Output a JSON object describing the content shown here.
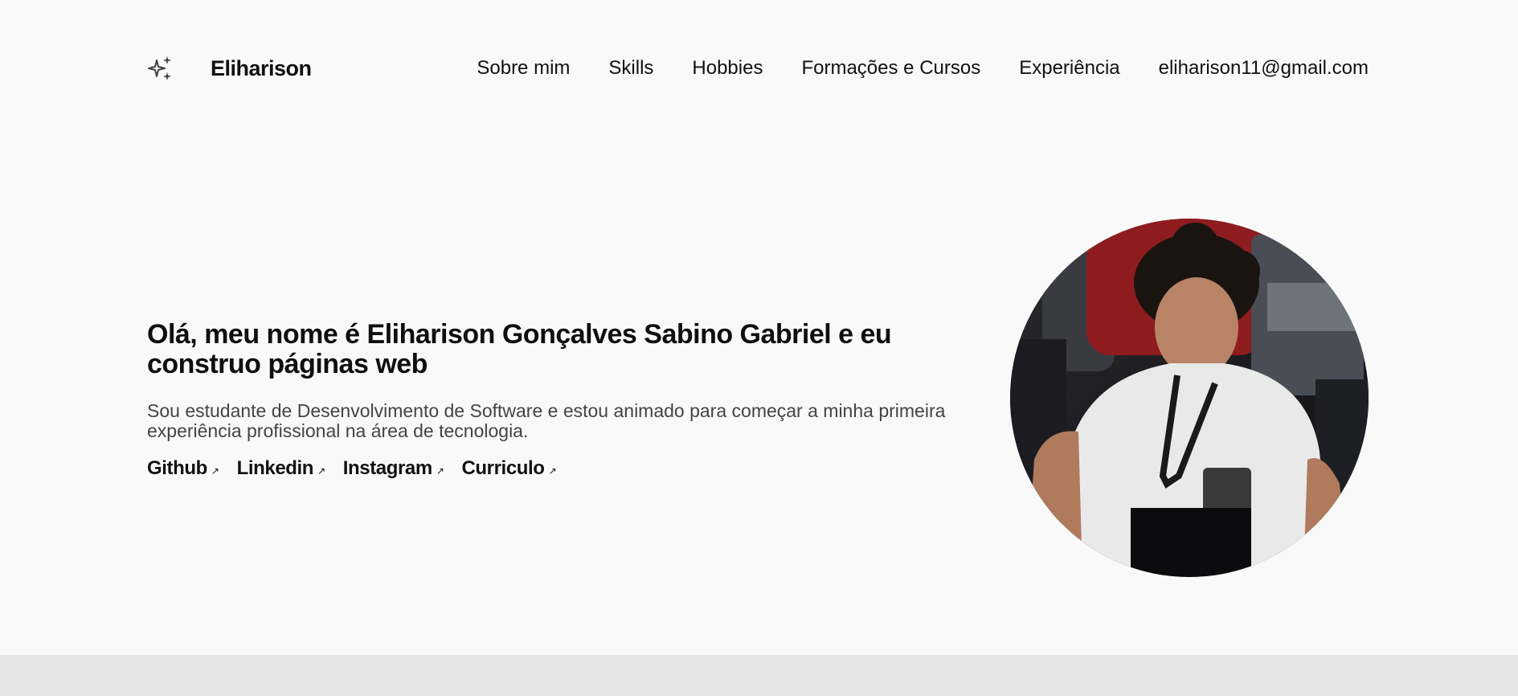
{
  "header": {
    "logo_icon": "sparkles-icon",
    "brand": "Eliharison",
    "nav": [
      {
        "label": "Sobre mim"
      },
      {
        "label": "Skills"
      },
      {
        "label": "Hobbies"
      },
      {
        "label": "Formações e Cursos"
      },
      {
        "label": "Experiência"
      },
      {
        "label": "eliharison11@gmail.com"
      }
    ]
  },
  "hero": {
    "title": "Olá, meu nome é Eliharison Gonçalves Sabino Gabriel e eu construo páginas web",
    "subtitle": "Sou estudante de Desenvolvimento de Software e estou animado para começar a minha primeira experiência profissional na área de tecnologia.",
    "links": [
      {
        "label": "Github",
        "arrow": "↗"
      },
      {
        "label": "Linkedin",
        "arrow": "↗"
      },
      {
        "label": "Instagram",
        "arrow": "↗"
      },
      {
        "label": "Curriculo",
        "arrow": "↗"
      }
    ],
    "photo_icon": "profile-photo"
  },
  "colors": {
    "background": "#f9f9f9",
    "footer_band": "#e6e6e6",
    "text": "#111111",
    "muted_text": "#444444"
  }
}
